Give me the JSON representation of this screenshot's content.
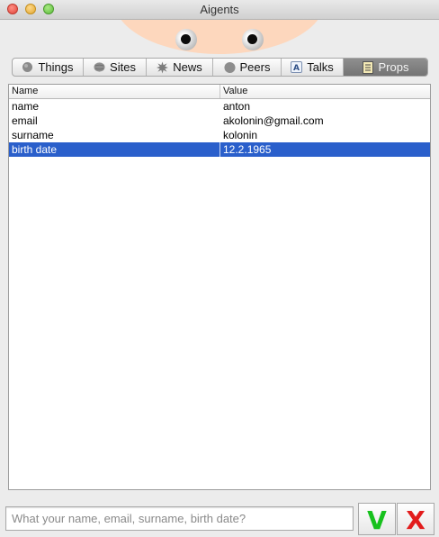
{
  "window": {
    "title": "Aigents"
  },
  "tabs": [
    {
      "label": "Things",
      "icon": "planet-icon",
      "active": false
    },
    {
      "label": "Sites",
      "icon": "globe-icon",
      "active": false
    },
    {
      "label": "News",
      "icon": "burst-icon",
      "active": false
    },
    {
      "label": "Peers",
      "icon": "person-icon",
      "active": false
    },
    {
      "label": "Talks",
      "icon": "chat-a-icon",
      "active": false
    },
    {
      "label": "Props",
      "icon": "notepad-icon",
      "active": true
    }
  ],
  "table": {
    "columns": [
      "Name",
      "Value"
    ],
    "rows": [
      {
        "name": "name",
        "value": "anton"
      },
      {
        "name": "email",
        "value": "akolonin@gmail.com"
      },
      {
        "name": "surname",
        "value": "kolonin"
      },
      {
        "name": "birth date",
        "value": "12.2.1965"
      }
    ],
    "selected_row": 3
  },
  "input": {
    "value": "",
    "placeholder": "What your name, email, surname, birth date?"
  },
  "buttons": {
    "ok": {
      "label": "V",
      "color": "#17c11d"
    },
    "cancel": {
      "label": "X",
      "color": "#e21c1c"
    }
  },
  "colors": {
    "selection": "#2a5fcb",
    "mascot_face": "#fdd7bd"
  }
}
